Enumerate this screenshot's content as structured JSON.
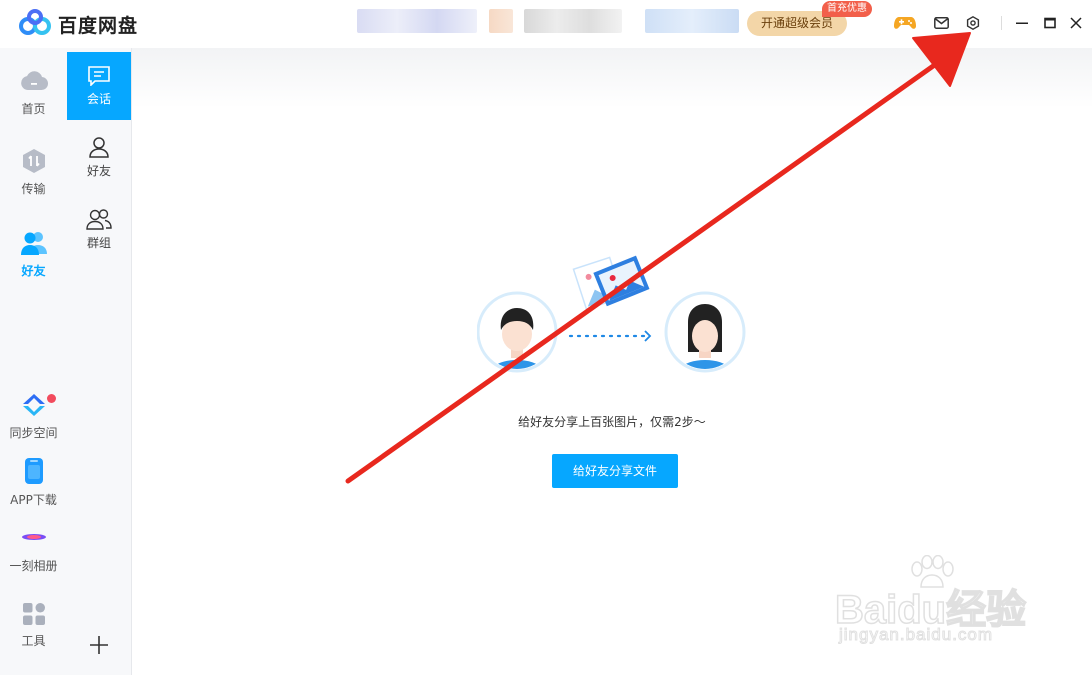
{
  "header": {
    "app_name": "百度网盘",
    "vip_button": "开通超级会员",
    "vip_badge": "首充优惠",
    "icons": [
      "game-icon",
      "mail-icon",
      "settings-icon",
      "minimize-icon",
      "maximize-icon",
      "close-icon"
    ]
  },
  "sidebar": {
    "items": [
      {
        "label": "首页",
        "icon": "cloud-icon"
      },
      {
        "label": "传输",
        "icon": "transfer-icon"
      },
      {
        "label": "好友",
        "icon": "friends-icon",
        "active": true
      },
      {
        "label": "同步空间",
        "icon": "sync-icon",
        "has_dot": true
      },
      {
        "label": "APP下载",
        "icon": "phone-icon"
      },
      {
        "label": "一刻相册",
        "icon": "album-icon"
      },
      {
        "label": "工具",
        "icon": "tools-icon"
      }
    ]
  },
  "panel": {
    "items": [
      {
        "label": "会话",
        "icon": "chat-icon",
        "active": true
      },
      {
        "label": "好友",
        "icon": "person-icon"
      },
      {
        "label": "群组",
        "icon": "group-icon"
      }
    ]
  },
  "main": {
    "hint": "给好友分享上百张图片，仅需2步～",
    "share_button": "给好友分享文件"
  },
  "watermark": {
    "line1": "Baidu经验",
    "line2": "jingyan.baidu.com"
  },
  "colors": {
    "accent": "#06a7ff",
    "arrow": "#e8281e",
    "vip": "#f3d6a8"
  }
}
